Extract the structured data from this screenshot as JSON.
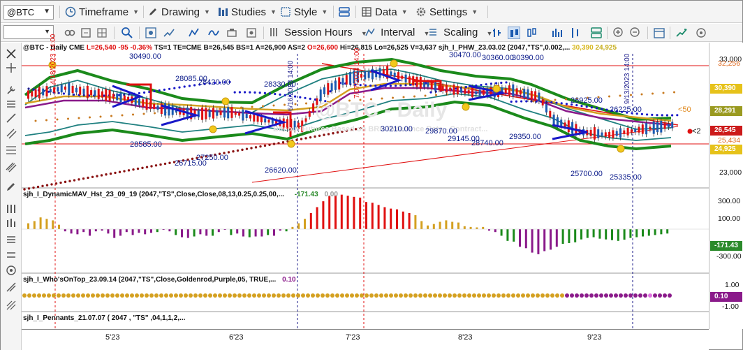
{
  "toolbar": {
    "symbol": "@BTC",
    "timeframe_label": "Timeframe",
    "drawing_label": "Drawing",
    "studies_label": "Studies",
    "style_label": "Style",
    "data_label": "Data",
    "settings_label": "Settings"
  },
  "toolbar2": {
    "session_label": "Session Hours",
    "interval_label": "Interval",
    "scaling_label": "Scaling"
  },
  "price_pane": {
    "header": "@BTC - Daily  CME",
    "low": "L=26,540",
    "change": "-95",
    "change_pct": "-0.36%",
    "ts": "TS=1",
    "te": "TE=CME",
    "bid": "B=26,545",
    "bs": "BS=1",
    "ask": "A=26,900",
    "as": "AS=2",
    "open": "O=26,600",
    "high": "Hi=26,815",
    "lo": "Lo=26,525",
    "volume": "V=3,637",
    "study": "sjh_I_PHW_23.03.02 (2047,\"TS\",0.002,...",
    "study_v1": "30,390",
    "study_v2": "24,925",
    "watermark": "@BTC - Daily",
    "watermark_sub": "Bitcoin Futures Based on BRR Reference Rate - Contract...",
    "labels": [
      "30490.00",
      "28085.00",
      "28420.00",
      "28330.00",
      "28585.00",
      "27250.00",
      "26715.00",
      "26620.00",
      "30210.00",
      "29870.00",
      "29145.00",
      "28740.00",
      "30470.00",
      "30360.00",
      "30390.00",
      "29350.00",
      "26925.00",
      "26225.00",
      "25700.00",
      "25335.00"
    ],
    "right_labels": [
      "33,000",
      "32,256",
      "30,390",
      "28,291",
      "26,545",
      "25,434",
      "24,925",
      "23,000"
    ],
    "right_marks": [
      "<50",
      "<2"
    ],
    "vtext": [
      "4/18/2023 14:00",
      "6/16/2023 14:00",
      "7/07/2023 14:00",
      "9/13/2023 14:00"
    ]
  },
  "pane2": {
    "title": "sjh_I_DynamicMAV_Hst_23_09_19 (2047,\"TS\",Close,Close,08,13,0.25,0.25,00,...",
    "v1": "-171.43",
    "v2": "0.00",
    "axis": [
      "300.00",
      "100.00",
      "-300.00"
    ],
    "tag": "-171.43",
    "bars": [
      40,
      55,
      80,
      70,
      60,
      30,
      -15,
      -30,
      -35,
      -20,
      -45,
      -15,
      -10,
      -30,
      -60,
      -45,
      -20,
      -40,
      -25,
      -35,
      -25,
      -20,
      -5,
      -15,
      -40,
      -55,
      -60,
      -50,
      -35,
      -45,
      -45,
      -20,
      -5,
      -40,
      -30,
      -50,
      -55,
      -50,
      -50,
      -40,
      -45,
      -10,
      -15,
      15,
      40,
      70,
      110,
      150,
      190,
      225,
      230,
      235,
      228,
      220,
      215,
      185,
      180,
      165,
      150,
      140,
      135,
      120,
      110,
      95,
      55,
      25,
      35,
      50,
      60,
      50,
      45,
      20,
      15,
      12,
      15,
      -10,
      -20,
      -45,
      -80,
      -85,
      -120,
      -130,
      -160,
      -171,
      -150,
      -140,
      -120,
      -100,
      -95,
      -90,
      -70,
      -60,
      -55,
      -65,
      -70,
      -75,
      -80,
      -72,
      -60,
      -55,
      -50,
      -45,
      -40,
      -35,
      -30,
      -25,
      -20,
      -15
    ]
  },
  "pane3": {
    "title": "sjh_I_Who'sOnTop_23.09.14 (2047,\"TS\",Close,Goldenrod,Purple,05,  TRUE,...",
    "v1": "0.10",
    "axis": [
      "1.00",
      "-1.00"
    ],
    "tag": "0.10"
  },
  "pane4": {
    "title": "sjh_I_Pennants_21.07.07 (  2047 ,  \"TS\" ,04,1,1,2,..."
  },
  "xaxis": [
    "5'23",
    "6'23",
    "7'23",
    "8'23",
    "9'23"
  ],
  "colors": {
    "red": "#e01010",
    "blue": "#1818c8",
    "green": "#1b8a1b",
    "teal": "#1f8080",
    "goldenrod": "#d4a020",
    "purple": "#8a1a8a",
    "darkred": "#8b1414",
    "olive": "#9a9a20",
    "price_tag": "#cc1a1a",
    "tag_green": "#2b8a2b",
    "tag_yellow": "#e6c21a",
    "tag_gold": "#d8b820",
    "tag_orange": "#e08a20"
  }
}
